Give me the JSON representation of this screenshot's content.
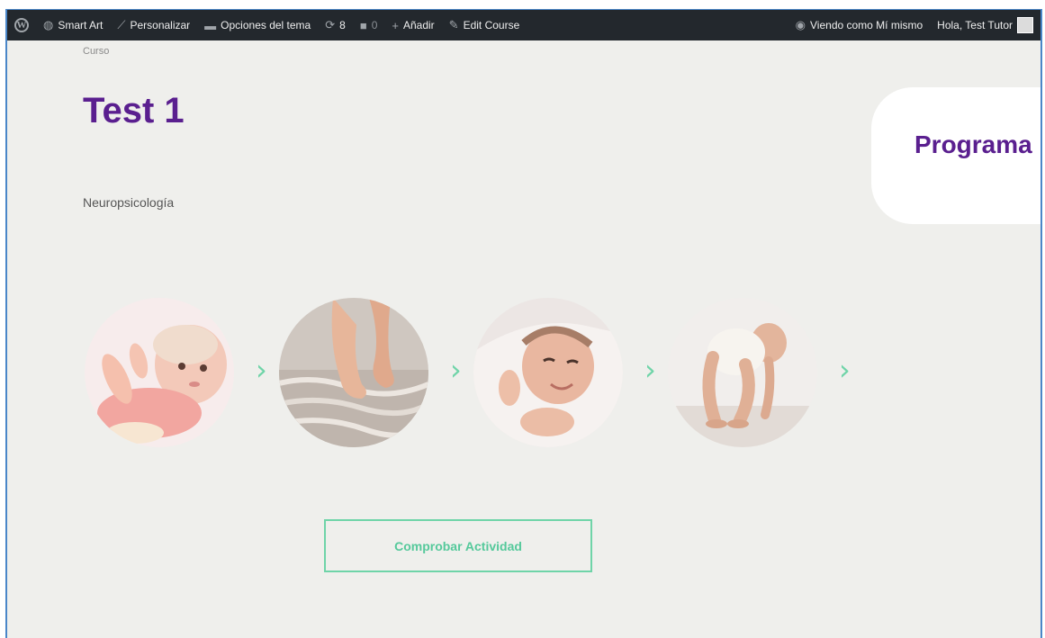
{
  "adminbar": {
    "wp_logo_glyph": "W",
    "items": [
      {
        "icon": "palette-icon",
        "label": "Smart Art"
      },
      {
        "icon": "brush-icon",
        "label": "Personalizar"
      },
      {
        "icon": "folder-icon",
        "label": "Opciones del tema"
      },
      {
        "icon": "updates-icon",
        "count": "8"
      },
      {
        "icon": "comments-icon",
        "count": "0"
      },
      {
        "icon": "plus-icon",
        "label": "Añadir"
      },
      {
        "icon": "pencil-icon",
        "label": "Edit Course"
      }
    ],
    "view_as": {
      "icon": "eye-icon",
      "label": "Viendo como Mí mismo"
    },
    "greeting": "Hola, Test Tutor"
  },
  "page": {
    "breadcrumb": "Curso",
    "title": "Test 1",
    "subtitle": "Neuropsicología",
    "program_card_title": "Programa",
    "action_button": "Comprobar Actividad"
  },
  "steps": [
    {
      "icon": "baby-lying-photo"
    },
    {
      "icon": "baby-feet-photo"
    },
    {
      "icon": "newborn-photo"
    },
    {
      "icon": "baby-standing-photo"
    }
  ],
  "colors": {
    "accent_purple": "#5a1f8f",
    "accent_green": "#6fd4a8",
    "admin_bar": "#23282d",
    "page_bg": "#efefec"
  }
}
